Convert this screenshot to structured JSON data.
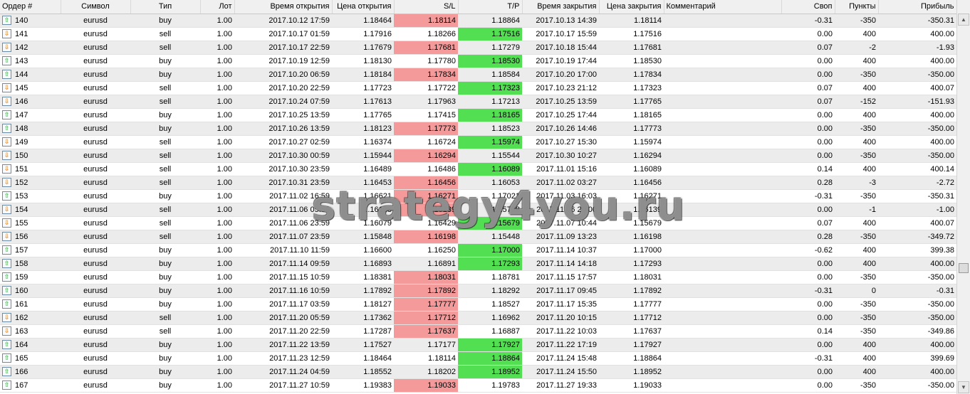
{
  "columns": [
    "Ордер #",
    "Символ",
    "Тип",
    "Лот",
    "Время открытия",
    "Цена открытия",
    "S/L",
    "T/P",
    "Время закрытия",
    "Цена закрытия",
    "Комментарий",
    "Своп",
    "Пункты",
    "Прибыль"
  ],
  "colors": {
    "sl_highlight": "#f59a9a",
    "tp_highlight": "#52e052",
    "row_alt": "#ececec"
  },
  "icons": {
    "buy": "buy-arrow-up-icon",
    "sell": "sell-arrow-down-icon"
  },
  "rows": [
    {
      "order": "140",
      "symbol": "eurusd",
      "type": "buy",
      "lot": "1.00",
      "open_time": "2017.10.12 17:59",
      "open_price": "1.18464",
      "sl": "1.18114",
      "tp": "1.18864",
      "close_time": "2017.10.13 14:39",
      "close_price": "1.18114",
      "comment": "",
      "swap": "-0.31",
      "points": "-350",
      "profit": "-350.31",
      "hit": "sl"
    },
    {
      "order": "141",
      "symbol": "eurusd",
      "type": "sell",
      "lot": "1.00",
      "open_time": "2017.10.17 01:59",
      "open_price": "1.17916",
      "sl": "1.18266",
      "tp": "1.17516",
      "close_time": "2017.10.17 15:59",
      "close_price": "1.17516",
      "comment": "",
      "swap": "0.00",
      "points": "400",
      "profit": "400.00",
      "hit": "tp"
    },
    {
      "order": "142",
      "symbol": "eurusd",
      "type": "sell",
      "lot": "1.00",
      "open_time": "2017.10.17 22:59",
      "open_price": "1.17679",
      "sl": "1.17681",
      "tp": "1.17279",
      "close_time": "2017.10.18 15:44",
      "close_price": "1.17681",
      "comment": "",
      "swap": "0.07",
      "points": "-2",
      "profit": "-1.93",
      "hit": "sl"
    },
    {
      "order": "143",
      "symbol": "eurusd",
      "type": "buy",
      "lot": "1.00",
      "open_time": "2017.10.19 12:59",
      "open_price": "1.18130",
      "sl": "1.17780",
      "tp": "1.18530",
      "close_time": "2017.10.19 17:44",
      "close_price": "1.18530",
      "comment": "",
      "swap": "0.00",
      "points": "400",
      "profit": "400.00",
      "hit": "tp"
    },
    {
      "order": "144",
      "symbol": "eurusd",
      "type": "buy",
      "lot": "1.00",
      "open_time": "2017.10.20 06:59",
      "open_price": "1.18184",
      "sl": "1.17834",
      "tp": "1.18584",
      "close_time": "2017.10.20 17:00",
      "close_price": "1.17834",
      "comment": "",
      "swap": "0.00",
      "points": "-350",
      "profit": "-350.00",
      "hit": "sl"
    },
    {
      "order": "145",
      "symbol": "eurusd",
      "type": "sell",
      "lot": "1.00",
      "open_time": "2017.10.20 22:59",
      "open_price": "1.17723",
      "sl": "1.17722",
      "tp": "1.17323",
      "close_time": "2017.10.23 21:12",
      "close_price": "1.17323",
      "comment": "",
      "swap": "0.07",
      "points": "400",
      "profit": "400.07",
      "hit": "tp"
    },
    {
      "order": "146",
      "symbol": "eurusd",
      "type": "sell",
      "lot": "1.00",
      "open_time": "2017.10.24 07:59",
      "open_price": "1.17613",
      "sl": "1.17963",
      "tp": "1.17213",
      "close_time": "2017.10.25 13:59",
      "close_price": "1.17765",
      "comment": "",
      "swap": "0.07",
      "points": "-152",
      "profit": "-151.93",
      "hit": ""
    },
    {
      "order": "147",
      "symbol": "eurusd",
      "type": "buy",
      "lot": "1.00",
      "open_time": "2017.10.25 13:59",
      "open_price": "1.17765",
      "sl": "1.17415",
      "tp": "1.18165",
      "close_time": "2017.10.25 17:44",
      "close_price": "1.18165",
      "comment": "",
      "swap": "0.00",
      "points": "400",
      "profit": "400.00",
      "hit": "tp"
    },
    {
      "order": "148",
      "symbol": "eurusd",
      "type": "buy",
      "lot": "1.00",
      "open_time": "2017.10.26 13:59",
      "open_price": "1.18123",
      "sl": "1.17773",
      "tp": "1.18523",
      "close_time": "2017.10.26 14:46",
      "close_price": "1.17773",
      "comment": "",
      "swap": "0.00",
      "points": "-350",
      "profit": "-350.00",
      "hit": "sl"
    },
    {
      "order": "149",
      "symbol": "eurusd",
      "type": "sell",
      "lot": "1.00",
      "open_time": "2017.10.27 02:59",
      "open_price": "1.16374",
      "sl": "1.16724",
      "tp": "1.15974",
      "close_time": "2017.10.27 15:30",
      "close_price": "1.15974",
      "comment": "",
      "swap": "0.00",
      "points": "400",
      "profit": "400.00",
      "hit": "tp"
    },
    {
      "order": "150",
      "symbol": "eurusd",
      "type": "sell",
      "lot": "1.00",
      "open_time": "2017.10.30 00:59",
      "open_price": "1.15944",
      "sl": "1.16294",
      "tp": "1.15544",
      "close_time": "2017.10.30 10:27",
      "close_price": "1.16294",
      "comment": "",
      "swap": "0.00",
      "points": "-350",
      "profit": "-350.00",
      "hit": "sl"
    },
    {
      "order": "151",
      "symbol": "eurusd",
      "type": "sell",
      "lot": "1.00",
      "open_time": "2017.10.30 23:59",
      "open_price": "1.16489",
      "sl": "1.16486",
      "tp": "1.16089",
      "close_time": "2017.11.01 15:16",
      "close_price": "1.16089",
      "comment": "",
      "swap": "0.14",
      "points": "400",
      "profit": "400.14",
      "hit": "tp"
    },
    {
      "order": "152",
      "symbol": "eurusd",
      "type": "sell",
      "lot": "1.00",
      "open_time": "2017.10.31 23:59",
      "open_price": "1.16453",
      "sl": "1.16456",
      "tp": "1.16053",
      "close_time": "2017.11.02 03:27",
      "close_price": "1.16456",
      "comment": "",
      "swap": "0.28",
      "points": "-3",
      "profit": "-2.72",
      "hit": "sl"
    },
    {
      "order": "153",
      "symbol": "eurusd",
      "type": "buy",
      "lot": "1.00",
      "open_time": "2017.11.02 16:59",
      "open_price": "1.16621",
      "sl": "1.16271",
      "tp": "1.17021",
      "close_time": "2017.11.03 16:03",
      "close_price": "1.16271",
      "comment": "",
      "swap": "-0.31",
      "points": "-350",
      "profit": "-350.31",
      "hit": "sl"
    },
    {
      "order": "154",
      "symbol": "eurusd",
      "type": "sell",
      "lot": "1.00",
      "open_time": "2017.11.06 05:59",
      "open_price": "1.16138",
      "sl": "1.16139",
      "tp": "1.15738",
      "close_time": "2017.11.06 20:00",
      "close_price": "1.16139",
      "comment": "",
      "swap": "0.00",
      "points": "-1",
      "profit": "-1.00",
      "hit": "sl"
    },
    {
      "order": "155",
      "symbol": "eurusd",
      "type": "sell",
      "lot": "1.00",
      "open_time": "2017.11.06 23:59",
      "open_price": "1.16079",
      "sl": "1.16429",
      "tp": "1.15679",
      "close_time": "2017.11.07 10:44",
      "close_price": "1.15679",
      "comment": "",
      "swap": "0.07",
      "points": "400",
      "profit": "400.07",
      "hit": "tp"
    },
    {
      "order": "156",
      "symbol": "eurusd",
      "type": "sell",
      "lot": "1.00",
      "open_time": "2017.11.07 23:59",
      "open_price": "1.15848",
      "sl": "1.16198",
      "tp": "1.15448",
      "close_time": "2017.11.09 13:23",
      "close_price": "1.16198",
      "comment": "",
      "swap": "0.28",
      "points": "-350",
      "profit": "-349.72",
      "hit": "sl"
    },
    {
      "order": "157",
      "symbol": "eurusd",
      "type": "buy",
      "lot": "1.00",
      "open_time": "2017.11.10 11:59",
      "open_price": "1.16600",
      "sl": "1.16250",
      "tp": "1.17000",
      "close_time": "2017.11.14 10:37",
      "close_price": "1.17000",
      "comment": "",
      "swap": "-0.62",
      "points": "400",
      "profit": "399.38",
      "hit": "tp"
    },
    {
      "order": "158",
      "symbol": "eurusd",
      "type": "buy",
      "lot": "1.00",
      "open_time": "2017.11.14 09:59",
      "open_price": "1.16893",
      "sl": "1.16891",
      "tp": "1.17293",
      "close_time": "2017.11.14 14:18",
      "close_price": "1.17293",
      "comment": "",
      "swap": "0.00",
      "points": "400",
      "profit": "400.00",
      "hit": "tp"
    },
    {
      "order": "159",
      "symbol": "eurusd",
      "type": "buy",
      "lot": "1.00",
      "open_time": "2017.11.15 10:59",
      "open_price": "1.18381",
      "sl": "1.18031",
      "tp": "1.18781",
      "close_time": "2017.11.15 17:57",
      "close_price": "1.18031",
      "comment": "",
      "swap": "0.00",
      "points": "-350",
      "profit": "-350.00",
      "hit": "sl"
    },
    {
      "order": "160",
      "symbol": "eurusd",
      "type": "buy",
      "lot": "1.00",
      "open_time": "2017.11.16 10:59",
      "open_price": "1.17892",
      "sl": "1.17892",
      "tp": "1.18292",
      "close_time": "2017.11.17 09:45",
      "close_price": "1.17892",
      "comment": "",
      "swap": "-0.31",
      "points": "0",
      "profit": "-0.31",
      "hit": "sl"
    },
    {
      "order": "161",
      "symbol": "eurusd",
      "type": "buy",
      "lot": "1.00",
      "open_time": "2017.11.17 03:59",
      "open_price": "1.18127",
      "sl": "1.17777",
      "tp": "1.18527",
      "close_time": "2017.11.17 15:35",
      "close_price": "1.17777",
      "comment": "",
      "swap": "0.00",
      "points": "-350",
      "profit": "-350.00",
      "hit": "sl"
    },
    {
      "order": "162",
      "symbol": "eurusd",
      "type": "sell",
      "lot": "1.00",
      "open_time": "2017.11.20 05:59",
      "open_price": "1.17362",
      "sl": "1.17712",
      "tp": "1.16962",
      "close_time": "2017.11.20 10:15",
      "close_price": "1.17712",
      "comment": "",
      "swap": "0.00",
      "points": "-350",
      "profit": "-350.00",
      "hit": "sl"
    },
    {
      "order": "163",
      "symbol": "eurusd",
      "type": "sell",
      "lot": "1.00",
      "open_time": "2017.11.20 22:59",
      "open_price": "1.17287",
      "sl": "1.17637",
      "tp": "1.16887",
      "close_time": "2017.11.22 10:03",
      "close_price": "1.17637",
      "comment": "",
      "swap": "0.14",
      "points": "-350",
      "profit": "-349.86",
      "hit": "sl"
    },
    {
      "order": "164",
      "symbol": "eurusd",
      "type": "buy",
      "lot": "1.00",
      "open_time": "2017.11.22 13:59",
      "open_price": "1.17527",
      "sl": "1.17177",
      "tp": "1.17927",
      "close_time": "2017.11.22 17:19",
      "close_price": "1.17927",
      "comment": "",
      "swap": "0.00",
      "points": "400",
      "profit": "400.00",
      "hit": "tp"
    },
    {
      "order": "165",
      "symbol": "eurusd",
      "type": "buy",
      "lot": "1.00",
      "open_time": "2017.11.23 12:59",
      "open_price": "1.18464",
      "sl": "1.18114",
      "tp": "1.18864",
      "close_time": "2017.11.24 15:48",
      "close_price": "1.18864",
      "comment": "",
      "swap": "-0.31",
      "points": "400",
      "profit": "399.69",
      "hit": "tp"
    },
    {
      "order": "166",
      "symbol": "eurusd",
      "type": "buy",
      "lot": "1.00",
      "open_time": "2017.11.24 04:59",
      "open_price": "1.18552",
      "sl": "1.18202",
      "tp": "1.18952",
      "close_time": "2017.11.24 15:50",
      "close_price": "1.18952",
      "comment": "",
      "swap": "0.00",
      "points": "400",
      "profit": "400.00",
      "hit": "tp"
    },
    {
      "order": "167",
      "symbol": "eurusd",
      "type": "buy",
      "lot": "1.00",
      "open_time": "2017.11.27 10:59",
      "open_price": "1.19383",
      "sl": "1.19033",
      "tp": "1.19783",
      "close_time": "2017.11.27 19:33",
      "close_price": "1.19033",
      "comment": "",
      "swap": "0.00",
      "points": "-350",
      "profit": "-350.00",
      "hit": "sl"
    }
  ],
  "watermark": "strategy4you.ru"
}
